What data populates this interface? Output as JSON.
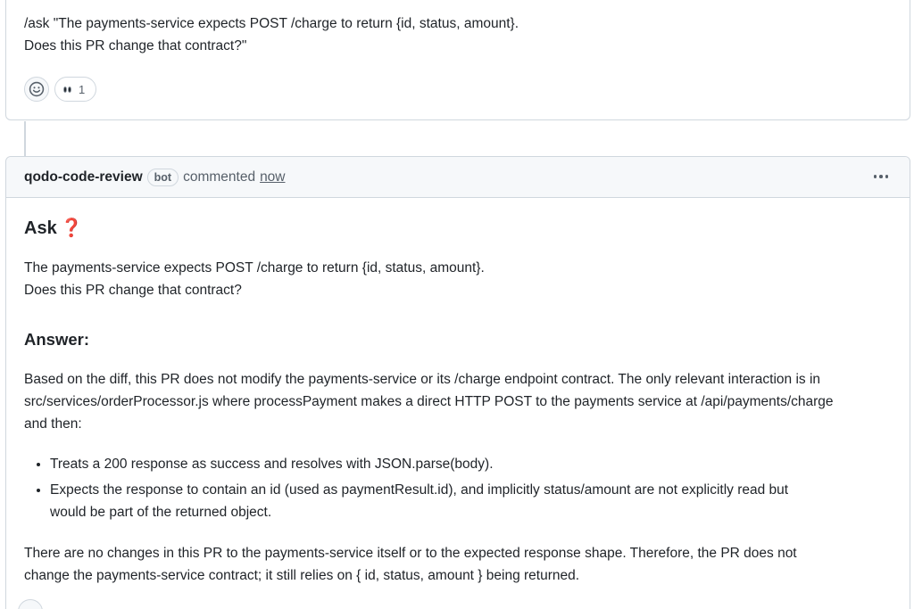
{
  "previous_comment": {
    "line1": "/ask \"The payments-service expects POST /charge to return {id, status, amount}.",
    "line2": "Does this PR change that contract?\"",
    "reaction": {
      "icon": "eyes-icon",
      "count": "1"
    }
  },
  "bot_comment": {
    "author": "qodo-code-review",
    "badge": "bot",
    "action": "commented",
    "time": "now",
    "ask_heading": "Ask",
    "ask_icon": "❓",
    "ask_line1": "The payments-service expects POST /charge to return {id, status, amount}.",
    "ask_line2": "Does this PR change that contract?",
    "answer_heading": "Answer:",
    "answer_line1": "Based on the diff, this PR does not modify the payments-service or its /charge endpoint contract. The only relevant interaction is in",
    "answer_line2": "src/services/orderProcessor.js where processPayment makes a direct HTTP POST to the payments service at /api/payments/charge",
    "answer_line3": "and then:",
    "bullets": [
      {
        "line1": "Treats a 200 response as success and resolves with JSON.parse(body).",
        "line2": ""
      },
      {
        "line1": "Expects the response to contain an id (used as paymentResult.id), and implicitly status/amount are not explicitly read but",
        "line2": "would be part of the returned object."
      }
    ],
    "conclusion_line1": "There are no changes in this PR to the payments-service itself or to the expected response shape. Therefore, the PR does not",
    "conclusion_line2": "change the payments-service contract; it still relies on { id, status, amount } being returned."
  }
}
